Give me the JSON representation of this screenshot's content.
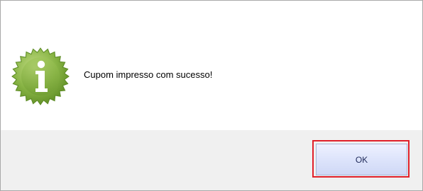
{
  "dialog": {
    "icon": "info-seal-icon",
    "message": "Cupom impresso com sucesso!",
    "ok_label": "OK"
  },
  "colors": {
    "icon_green": "#7aa83a",
    "highlight_red": "#e0202a",
    "footer_bg": "#f0f0f0"
  }
}
